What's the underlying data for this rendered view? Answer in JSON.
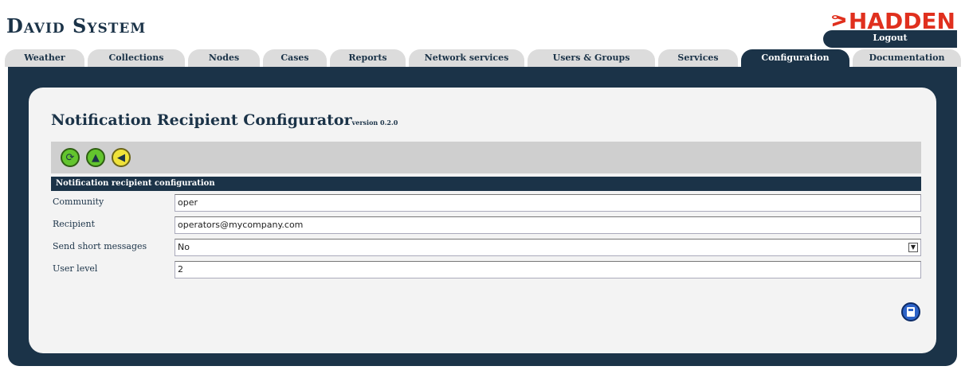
{
  "header": {
    "brand": "David System",
    "logo": "HADDEN",
    "logo_mark": "ᕗ",
    "logout_label": "Logout"
  },
  "tabs": [
    {
      "label": "Weather",
      "active": false
    },
    {
      "label": "Collections",
      "active": false
    },
    {
      "label": "Nodes",
      "active": false
    },
    {
      "label": "Cases",
      "active": false
    },
    {
      "label": "Reports",
      "active": false
    },
    {
      "label": "Network services",
      "active": false
    },
    {
      "label": "Users & Groups",
      "active": false
    },
    {
      "label": "Services",
      "active": false
    },
    {
      "label": "Configuration",
      "active": true
    },
    {
      "label": "Documentation",
      "active": false
    }
  ],
  "page": {
    "title": "Notification Recipient Configurator",
    "version": "version 0.2.0"
  },
  "toolbar": {
    "refresh_icon": "refresh-icon",
    "up_icon": "up-icon",
    "back_icon": "back-icon"
  },
  "section": {
    "heading": "Notification recipient configuration"
  },
  "form": {
    "community_label": "Community",
    "community_value": "oper",
    "recipient_label": "Recipient",
    "recipient_value": "operators@mycompany.com",
    "sms_label": "Send short messages",
    "sms_value": "No",
    "level_label": "User level",
    "level_value": "2"
  },
  "colors": {
    "navy": "#1b3348",
    "logo_red": "#e0301e",
    "button_green": "#63c52e",
    "button_yellow": "#efe23a",
    "save_blue": "#2d63c8"
  }
}
